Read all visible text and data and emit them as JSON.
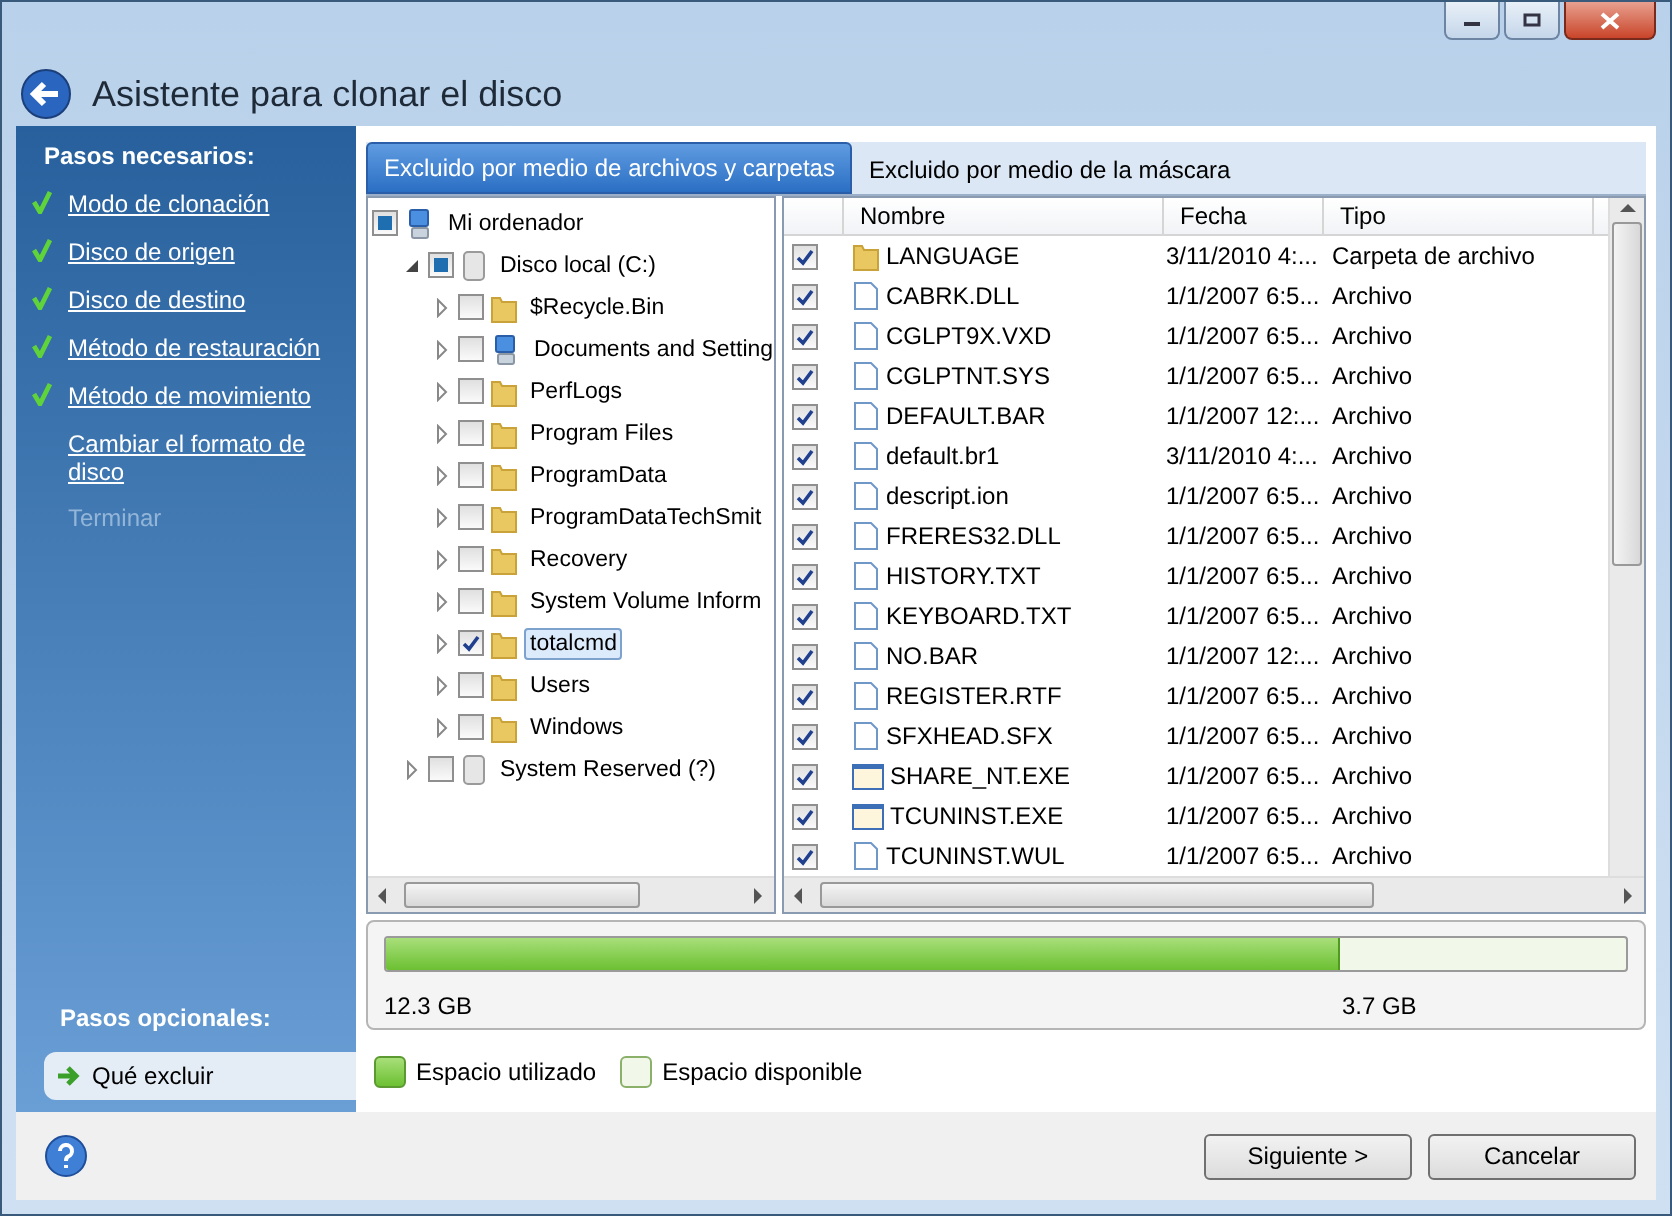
{
  "window": {
    "title": "Asistente para clonar el disco"
  },
  "sidebar": {
    "required_heading": "Pasos necesarios:",
    "steps": [
      {
        "label": "Modo de clonación",
        "done": true,
        "disabled": false
      },
      {
        "label": "Disco de origen",
        "done": true,
        "disabled": false
      },
      {
        "label": "Disco de destino",
        "done": true,
        "disabled": false
      },
      {
        "label": "Método de restauración",
        "done": true,
        "disabled": false
      },
      {
        "label": "Método de movimiento",
        "done": true,
        "disabled": false
      },
      {
        "label": "Cambiar el formato de disco",
        "done": false,
        "disabled": false
      },
      {
        "label": "Terminar",
        "done": false,
        "disabled": true
      }
    ],
    "optional_heading": "Pasos opcionales:",
    "optional_steps": [
      {
        "label": "Qué excluir",
        "selected": true
      }
    ]
  },
  "tabs": [
    {
      "label": "Excluido por medio de archivos y carpetas",
      "selected": true
    },
    {
      "label": "Excluido por medio de la máscara",
      "selected": false
    }
  ],
  "tree": [
    {
      "label": "Mi ordenador",
      "kind": "computer",
      "checked": false,
      "partial": true,
      "expanded": true,
      "selected": false,
      "children": [
        {
          "label": "Disco local (C:)",
          "kind": "drive",
          "checked": false,
          "partial": true,
          "expanded": true,
          "selected": false,
          "children": [
            {
              "label": "$Recycle.Bin",
              "kind": "folder",
              "checked": false,
              "partial": false,
              "expanded": false,
              "selected": false
            },
            {
              "label": "Documents and Setting",
              "kind": "computer",
              "checked": false,
              "partial": false,
              "expanded": false,
              "selected": false
            },
            {
              "label": "PerfLogs",
              "kind": "folder",
              "checked": false,
              "partial": false,
              "expanded": false,
              "selected": false
            },
            {
              "label": "Program Files",
              "kind": "folder",
              "checked": false,
              "partial": false,
              "expanded": false,
              "selected": false
            },
            {
              "label": "ProgramData",
              "kind": "folder",
              "checked": false,
              "partial": false,
              "expanded": false,
              "selected": false
            },
            {
              "label": "ProgramDataTechSmit",
              "kind": "folder",
              "checked": false,
              "partial": false,
              "expanded": false,
              "selected": false
            },
            {
              "label": "Recovery",
              "kind": "folder",
              "checked": false,
              "partial": false,
              "expanded": false,
              "selected": false
            },
            {
              "label": "System Volume Inform",
              "kind": "folder",
              "checked": false,
              "partial": false,
              "expanded": false,
              "selected": false
            },
            {
              "label": "totalcmd",
              "kind": "folder",
              "checked": true,
              "partial": false,
              "expanded": false,
              "selected": true
            },
            {
              "label": "Users",
              "kind": "folder",
              "checked": false,
              "partial": false,
              "expanded": false,
              "selected": false
            },
            {
              "label": "Windows",
              "kind": "folder",
              "checked": false,
              "partial": false,
              "expanded": false,
              "selected": false
            }
          ]
        },
        {
          "label": "System Reserved (?)",
          "kind": "drive",
          "checked": false,
          "partial": false,
          "expanded": false,
          "selected": false
        }
      ]
    }
  ],
  "table": {
    "columns": [
      "Nombre",
      "Fecha",
      "Tipo"
    ],
    "rows": [
      {
        "name": "LANGUAGE",
        "kind": "folder",
        "checked": true,
        "date": "3/11/2010 4:...",
        "type": "Carpeta de archivo"
      },
      {
        "name": "CABRK.DLL",
        "kind": "file",
        "checked": true,
        "date": "1/1/2007 6:5...",
        "type": "Archivo"
      },
      {
        "name": "CGLPT9X.VXD",
        "kind": "file",
        "checked": true,
        "date": "1/1/2007 6:5...",
        "type": "Archivo"
      },
      {
        "name": "CGLPTNT.SYS",
        "kind": "file",
        "checked": true,
        "date": "1/1/2007 6:5...",
        "type": "Archivo"
      },
      {
        "name": "DEFAULT.BAR",
        "kind": "file",
        "checked": true,
        "date": "1/1/2007 12:...",
        "type": "Archivo"
      },
      {
        "name": "default.br1",
        "kind": "file",
        "checked": true,
        "date": "3/11/2010 4:...",
        "type": "Archivo"
      },
      {
        "name": "descript.ion",
        "kind": "file",
        "checked": true,
        "date": "1/1/2007 6:5...",
        "type": "Archivo"
      },
      {
        "name": "FRERES32.DLL",
        "kind": "file",
        "checked": true,
        "date": "1/1/2007 6:5...",
        "type": "Archivo"
      },
      {
        "name": "HISTORY.TXT",
        "kind": "file",
        "checked": true,
        "date": "1/1/2007 6:5...",
        "type": "Archivo"
      },
      {
        "name": "KEYBOARD.TXT",
        "kind": "file",
        "checked": true,
        "date": "1/1/2007 6:5...",
        "type": "Archivo"
      },
      {
        "name": "NO.BAR",
        "kind": "file",
        "checked": true,
        "date": "1/1/2007 12:...",
        "type": "Archivo"
      },
      {
        "name": "REGISTER.RTF",
        "kind": "file",
        "checked": true,
        "date": "1/1/2007 6:5...",
        "type": "Archivo"
      },
      {
        "name": "SFXHEAD.SFX",
        "kind": "file",
        "checked": true,
        "date": "1/1/2007 6:5...",
        "type": "Archivo"
      },
      {
        "name": "SHARE_NT.EXE",
        "kind": "program",
        "checked": true,
        "date": "1/1/2007 6:5...",
        "type": "Archivo"
      },
      {
        "name": "TCUNINST.EXE",
        "kind": "program",
        "checked": true,
        "date": "1/1/2007 6:5...",
        "type": "Archivo"
      },
      {
        "name": "TCUNINST.WUL",
        "kind": "file",
        "checked": true,
        "date": "1/1/2007 6:5...",
        "type": "Archivo"
      }
    ]
  },
  "disk_bar": {
    "level": 0.77,
    "used": "12.3 GB",
    "free": "3.7 GB"
  },
  "legend": [
    {
      "label": "Espacio utilizado",
      "kind": "used"
    },
    {
      "label": "Espacio disponible",
      "kind": "free"
    }
  ],
  "buttons": [
    "Siguiente >",
    "Cancelar"
  ]
}
